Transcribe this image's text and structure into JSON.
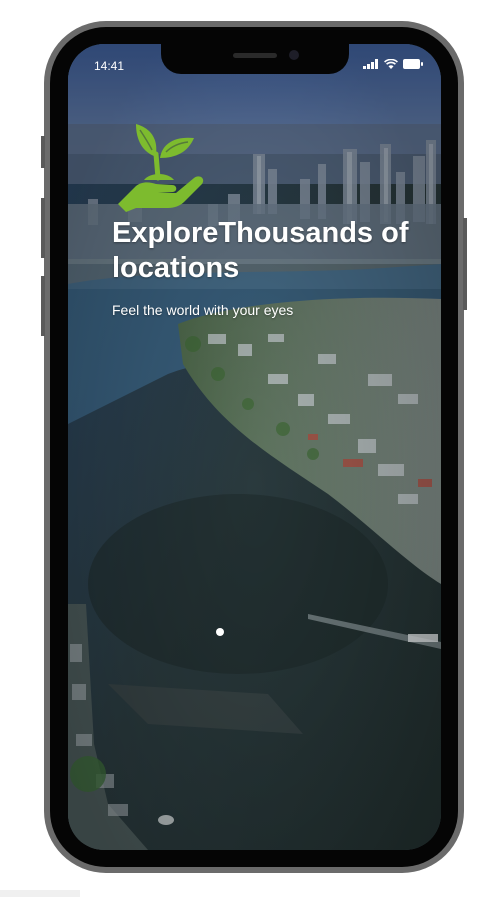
{
  "status_bar": {
    "time": "14:41",
    "icons": [
      "cellular-signal-icon",
      "wifi-icon",
      "battery-icon"
    ]
  },
  "onboarding": {
    "logo_icon": "plant-in-hand-icon",
    "headline": "ExploreThousands of locations",
    "subheadline": "Feel the world with your eyes",
    "page_indicator": {
      "total": 1,
      "active": 1
    }
  },
  "colors": {
    "logo_green": "#7dbb2e",
    "text": "#ffffff",
    "phone_frame": "#6b6b6b"
  }
}
